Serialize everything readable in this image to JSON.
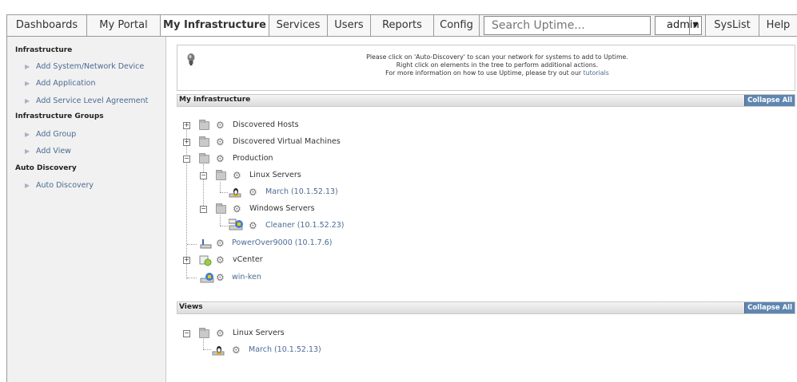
{
  "nav": {
    "tabs": [
      "Dashboards",
      "My Portal",
      "My Infrastructure",
      "Services",
      "Users",
      "Reports",
      "Config"
    ],
    "active_tab": "My Infrastructure",
    "search_placeholder": "Search Uptime...",
    "user": "admin",
    "syslist": "SysList",
    "help": "Help"
  },
  "sidebar": {
    "sections": [
      {
        "title": "Infrastructure",
        "items": [
          "Add System/Network Device",
          "Add Application",
          "Add Service Level Agreement"
        ]
      },
      {
        "title": "Infrastructure Groups",
        "items": [
          "Add Group",
          "Add View"
        ]
      },
      {
        "title": "Auto Discovery",
        "items": [
          "Auto Discovery"
        ]
      }
    ]
  },
  "info": {
    "line1": "Please click on 'Auto-Discovery' to scan your network for systems to add to Uptime.",
    "line2": "Right click on elements in the tree to perform additional actions.",
    "line3_prefix": "For more information on how to use Uptime, please try out our",
    "line3_link": "tutorials"
  },
  "infrastructure": {
    "title": "My Infrastructure",
    "collapse": "Collapse All",
    "nodes": [
      "Discovered Hosts",
      "Discovered Virtual Machines",
      "Production",
      "Linux Servers",
      "March (10.1.52.13)",
      "Windows Servers",
      "Cleaner (10.1.52.23)",
      "PowerOver9000 (10.1.7.6)",
      "vCenter",
      "win-ken"
    ]
  },
  "views": {
    "title": "Views",
    "collapse": "Collapse All",
    "nodes": [
      "Linux Servers",
      "March (10.1.52.13)"
    ]
  },
  "colors": {
    "accent": "#5f86b0",
    "link": "#4b6b94",
    "sidebar_bg": "#f1f1f1"
  }
}
